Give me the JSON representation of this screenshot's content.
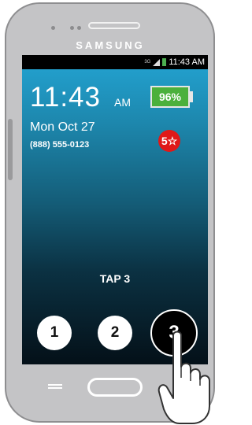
{
  "device": {
    "brand": "SAMSUNG"
  },
  "status_bar": {
    "network": "3G",
    "time": "11:43 AM"
  },
  "lock_screen": {
    "time": "11:43",
    "ampm": "AM",
    "battery": "96%",
    "date": "Mon Oct 27",
    "phone_number": "(888) 555-0123",
    "badge": "5☆"
  },
  "instruction": "TAP 3",
  "buttons": [
    {
      "label": "1"
    },
    {
      "label": "2"
    },
    {
      "label": "3"
    }
  ],
  "colors": {
    "battery": "#4bb03c",
    "badge": "#e01818",
    "screen_top": "#23a4d3",
    "screen_bottom": "#041018"
  }
}
